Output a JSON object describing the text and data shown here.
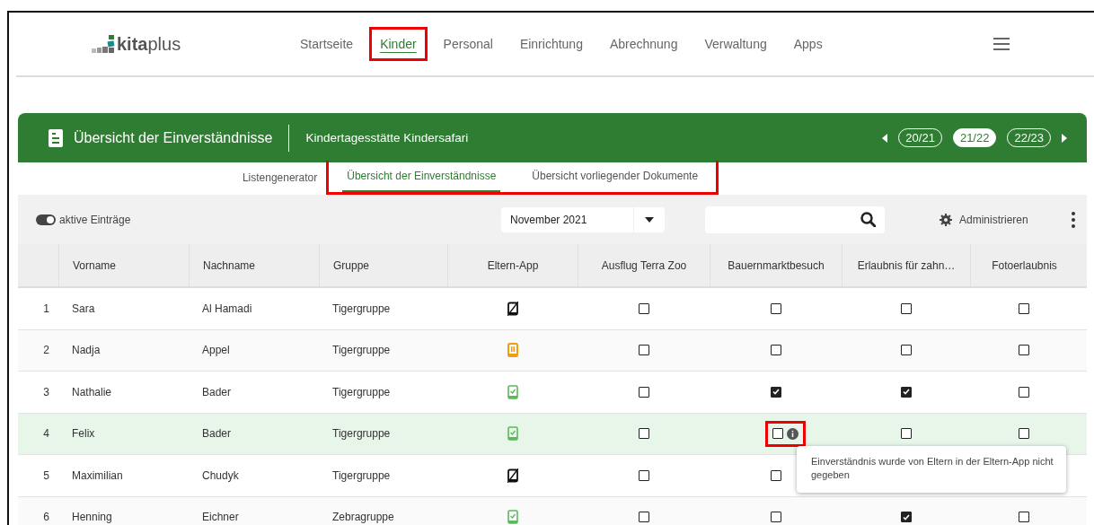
{
  "logo": {
    "text_bold": "kita",
    "text_light": "plus"
  },
  "nav": [
    {
      "label": "Startseite",
      "selected": false,
      "highlighted": false
    },
    {
      "label": "Kinder",
      "selected": true,
      "highlighted": true
    },
    {
      "label": "Personal",
      "selected": false,
      "highlighted": false
    },
    {
      "label": "Einrichtung",
      "selected": false,
      "highlighted": false
    },
    {
      "label": "Abrechnung",
      "selected": false,
      "highlighted": false
    },
    {
      "label": "Verwaltung",
      "selected": false,
      "highlighted": false
    },
    {
      "label": "Apps",
      "selected": false,
      "highlighted": false
    }
  ],
  "card": {
    "title": "Übersicht der Einverständnisse",
    "facility": "Kindertagesstätte Kindersafari",
    "years": [
      {
        "label": "20/21",
        "selected": false
      },
      {
        "label": "21/22",
        "selected": true
      },
      {
        "label": "22/23",
        "selected": false
      }
    ]
  },
  "subtabs": [
    {
      "label": "Listengenerator",
      "selected": false,
      "highlighted": false
    },
    {
      "label": "Übersicht der Einverständnisse",
      "selected": true,
      "highlighted": true
    },
    {
      "label": "Übersicht vorliegender Dokumente",
      "selected": false,
      "highlighted": true
    }
  ],
  "toolbar": {
    "toggle": {
      "label": "aktive Einträge",
      "on": true
    },
    "month": "November 2021",
    "admin": "Administrieren"
  },
  "table": {
    "columns": [
      "Vorname",
      "Nachname",
      "Gruppe",
      "Eltern-App",
      "Ausflug Terra Zoo",
      "Bauernmarktbesuch",
      "Erlaubnis für zahn…",
      "Fotoerlaubnis"
    ],
    "rows": [
      {
        "index": "1",
        "first": "Sara",
        "last": "Al Hamadi",
        "group": "Tigergruppe",
        "app": {
          "kind": "none"
        },
        "selected": false,
        "consents": [
          {
            "checked": false,
            "info": false,
            "highlighted": false
          },
          {
            "checked": false,
            "info": false,
            "highlighted": false
          },
          {
            "checked": false,
            "info": false,
            "highlighted": false
          },
          {
            "checked": false,
            "info": false,
            "highlighted": false
          }
        ]
      },
      {
        "index": "2",
        "first": "Nadja",
        "last": "Appel",
        "group": "Tigergruppe",
        "app": {
          "kind": "pending"
        },
        "selected": false,
        "consents": [
          {
            "checked": false,
            "info": false,
            "highlighted": false
          },
          {
            "checked": false,
            "info": false,
            "highlighted": false
          },
          {
            "checked": false,
            "info": false,
            "highlighted": false
          },
          {
            "checked": false,
            "info": false,
            "highlighted": false
          }
        ]
      },
      {
        "index": "3",
        "first": "Nathalie",
        "last": "Bader",
        "group": "Tigergruppe",
        "app": {
          "kind": "active"
        },
        "selected": false,
        "consents": [
          {
            "checked": false,
            "info": false,
            "highlighted": false
          },
          {
            "checked": true,
            "info": false,
            "highlighted": false
          },
          {
            "checked": true,
            "info": false,
            "highlighted": false
          },
          {
            "checked": false,
            "info": false,
            "highlighted": false
          }
        ]
      },
      {
        "index": "4",
        "first": "Felix",
        "last": "Bader",
        "group": "Tigergruppe",
        "app": {
          "kind": "active"
        },
        "selected": true,
        "consents": [
          {
            "checked": false,
            "info": false,
            "highlighted": false
          },
          {
            "checked": false,
            "info": true,
            "highlighted": true,
            "tooltip": "Einverständnis wurde von Eltern in der Eltern-App nicht gegeben"
          },
          {
            "checked": false,
            "info": false,
            "highlighted": false
          },
          {
            "checked": false,
            "info": false,
            "highlighted": false
          }
        ]
      },
      {
        "index": "5",
        "first": "Maximilian",
        "last": "Chudyk",
        "group": "Tigergruppe",
        "app": {
          "kind": "none"
        },
        "selected": false,
        "consents": [
          {
            "checked": false,
            "info": false,
            "highlighted": false
          },
          {
            "checked": false,
            "info": false,
            "highlighted": false
          }
        ]
      },
      {
        "index": "6",
        "first": "Henning",
        "last": "Eichner",
        "group": "Zebragruppe",
        "app": {
          "kind": "active"
        },
        "selected": false,
        "consents": [
          {
            "checked": false,
            "info": false,
            "highlighted": false
          },
          {
            "checked": false,
            "info": false,
            "highlighted": false
          },
          {
            "checked": true,
            "info": false,
            "highlighted": false
          },
          {
            "checked": false,
            "info": false,
            "highlighted": false
          }
        ]
      }
    ]
  }
}
